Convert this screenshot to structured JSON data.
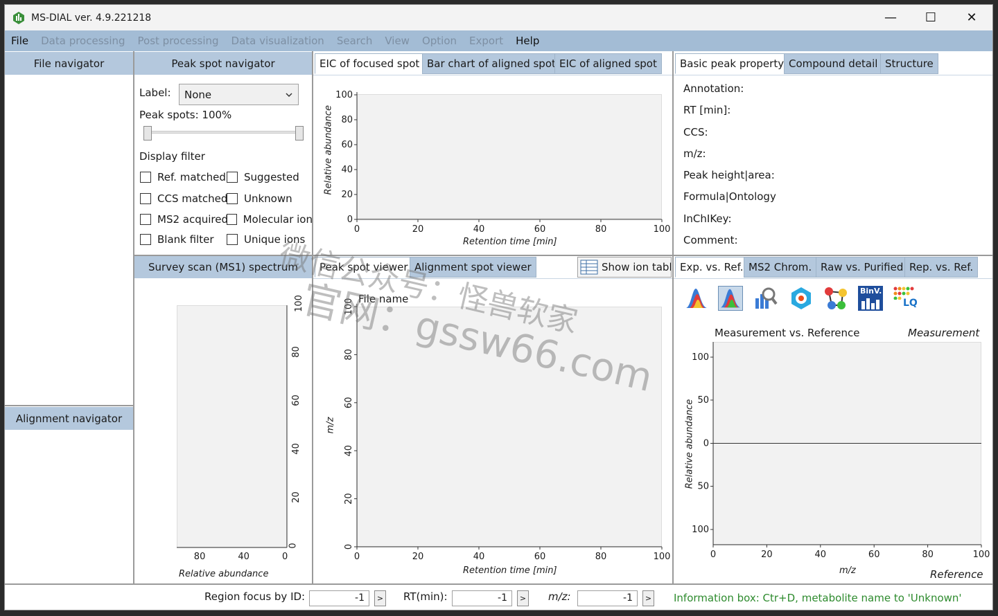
{
  "window": {
    "title": "MS-DIAL ver. 4.9.221218",
    "min": "—",
    "max": "☐",
    "close": "✕"
  },
  "menu": [
    "File",
    "Data processing",
    "Post processing",
    "Data visualization",
    "Search",
    "View",
    "Option",
    "Export",
    "Help"
  ],
  "menu_enabled": [
    true,
    false,
    false,
    false,
    false,
    false,
    false,
    false,
    true
  ],
  "file_navigator": {
    "header": "File navigator"
  },
  "alignment_navigator": {
    "header": "Alignment navigator"
  },
  "peak_spot_navigator": {
    "header": "Peak spot navigator",
    "label_caption": "Label:",
    "label_value": "None",
    "peak_spots": "Peak spots: 100%",
    "display_filter": "Display filter",
    "filters": [
      {
        "label": "Ref. matched",
        "checked": false
      },
      {
        "label": "Suggested",
        "checked": false
      },
      {
        "label": "CCS matched",
        "checked": false
      },
      {
        "label": "Unknown",
        "checked": false
      },
      {
        "label": "MS2 acquired",
        "checked": false
      },
      {
        "label": "Molecular ion",
        "checked": false
      },
      {
        "label": "Blank filter",
        "checked": false
      },
      {
        "label": "Unique ions",
        "checked": false
      }
    ]
  },
  "eic_tabs": [
    "EIC of focused spot",
    "Bar chart of aligned spot",
    "EIC of aligned spot"
  ],
  "prop_tabs": [
    "Basic peak property",
    "Compound detail",
    "Structure"
  ],
  "properties": [
    "Annotation:",
    "RT [min]:",
    "CCS:",
    "m/z:",
    "Peak height|area:",
    "Formula|Ontology",
    "InChIKey:",
    "Comment:"
  ],
  "survey": {
    "header": "Survey scan (MS1) spectrum",
    "xlabel": "Relative abundance",
    "x_ticks": [
      "80",
      "40",
      "0"
    ],
    "y_ticks": [
      "100",
      "80",
      "60",
      "40",
      "20",
      "0"
    ]
  },
  "viewer_tabs": [
    "Peak spot viewer",
    "Alignment spot viewer"
  ],
  "show_ion_table": "Show ion table",
  "ms2_tabs": [
    "Exp. vs. Ref.",
    "MS2 Chrom.",
    "Raw vs. Purified",
    "Rep. vs. Ref."
  ],
  "ms2_icons": [
    "peak-shape-icon",
    "peak-shape-selected-icon",
    "search-chart-icon",
    "molecule-search-icon",
    "network-icon",
    "binvestigate-icon",
    "lipidquest-icon"
  ],
  "ms2_icon_labels": {
    "binv": "BinV.",
    "lq": "LQ"
  },
  "ms2_plot": {
    "title": "Measurement vs. Reference",
    "top_label": "Measurement",
    "bottom_label": "Reference",
    "xlabel": "m/z",
    "ylabel": "Relative abundance",
    "y_ticks": [
      "100",
      "50",
      "0",
      "50",
      "100"
    ],
    "x_ticks": [
      "0",
      "20",
      "40",
      "60",
      "80",
      "100"
    ]
  },
  "chart_data": [
    {
      "type": "line",
      "title": "",
      "xlabel": "Retention time [min]",
      "ylabel": "Relative abundance",
      "xlim": [
        0,
        100
      ],
      "ylim": [
        0,
        100
      ],
      "x_ticks": [
        "0",
        "20",
        "40",
        "60",
        "80",
        "100"
      ],
      "y_ticks": [
        "100",
        "80",
        "60",
        "40",
        "20",
        "0"
      ],
      "series": []
    },
    {
      "type": "scatter",
      "title": "File name",
      "xlabel": "Retention time [min]",
      "ylabel": "m/z",
      "xlim": [
        0,
        100
      ],
      "ylim": [
        0,
        100
      ],
      "x_ticks": [
        "0",
        "20",
        "40",
        "60",
        "80",
        "100"
      ],
      "y_ticks": [
        "100",
        "80",
        "60",
        "40",
        "20",
        "0"
      ],
      "series": []
    }
  ],
  "status": {
    "region_label": "Region focus by ID:",
    "region_value": "-1",
    "rt_label": "RT(min):",
    "rt_value": "-1",
    "mz_label": "m/z:",
    "mz_value": "-1",
    "go": ">",
    "info": "Information box: Ctr+D, metabolite name to 'Unknown'",
    "info_color": "#2e8b2e"
  },
  "watermark": {
    "line1": "微信公众号：怪兽软家",
    "line2": "官网：gssw66.com"
  }
}
